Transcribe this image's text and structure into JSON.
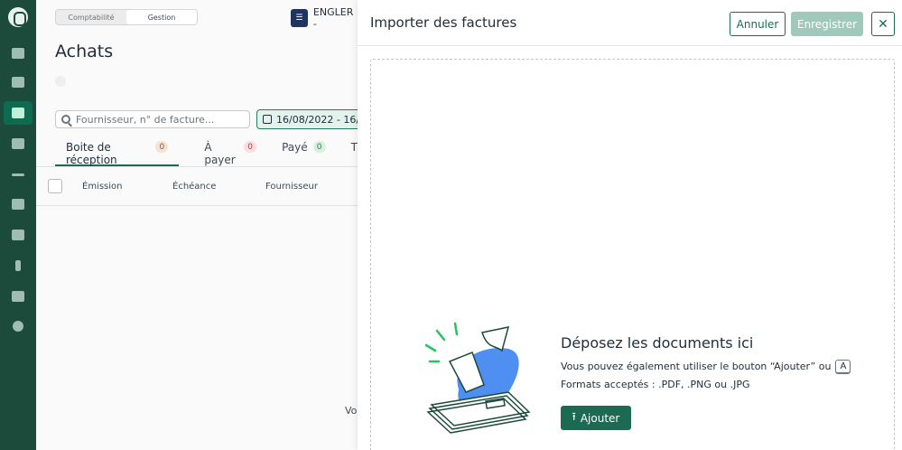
{
  "sidebar": {
    "items": [
      {
        "icon": "bank-icon"
      },
      {
        "icon": "wallet-icon"
      },
      {
        "icon": "cart-icon",
        "active": true
      },
      {
        "icon": "store-icon"
      },
      {
        "icon": "chart-line-icon"
      },
      {
        "icon": "folder-icon"
      },
      {
        "icon": "spreadsheet-icon"
      },
      {
        "icon": "transfer-icon"
      },
      {
        "icon": "briefcase-icon"
      },
      {
        "icon": "gear-icon"
      }
    ]
  },
  "main": {
    "mode_switch": {
      "option1": "Comptabilité",
      "option2": "Gestion"
    },
    "company": {
      "badge": "☰",
      "name": "ENGLER -"
    },
    "page_title": "Achats",
    "search_placeholder": "Fournisseur, n° de facture...",
    "date_filter": "16/08/2022 - 16/",
    "tabs": [
      {
        "label": "Boite de réception",
        "count": "0"
      },
      {
        "label": "À payer",
        "count": "0"
      },
      {
        "label": "Payé",
        "count": "0"
      },
      {
        "label": "T"
      }
    ],
    "columns": {
      "c1": "Émission",
      "c2": "Échéance",
      "c3": "Fournisseur"
    },
    "bottom_fragment": "Vo"
  },
  "panel": {
    "title": "Importer des factures",
    "cancel_label": "Annuler",
    "save_label": "Enregistrer",
    "close_symbol": "✕",
    "drop_title": "Déposez les documents ici",
    "drop_line1": "Vous pouvez également utiliser le bouton “Ajouter” ou",
    "kbd": "A",
    "drop_line2": "Formats acceptés : .PDF, .PNG ou .JPG",
    "add_label": "Ajouter",
    "add_icon": "⭱"
  }
}
